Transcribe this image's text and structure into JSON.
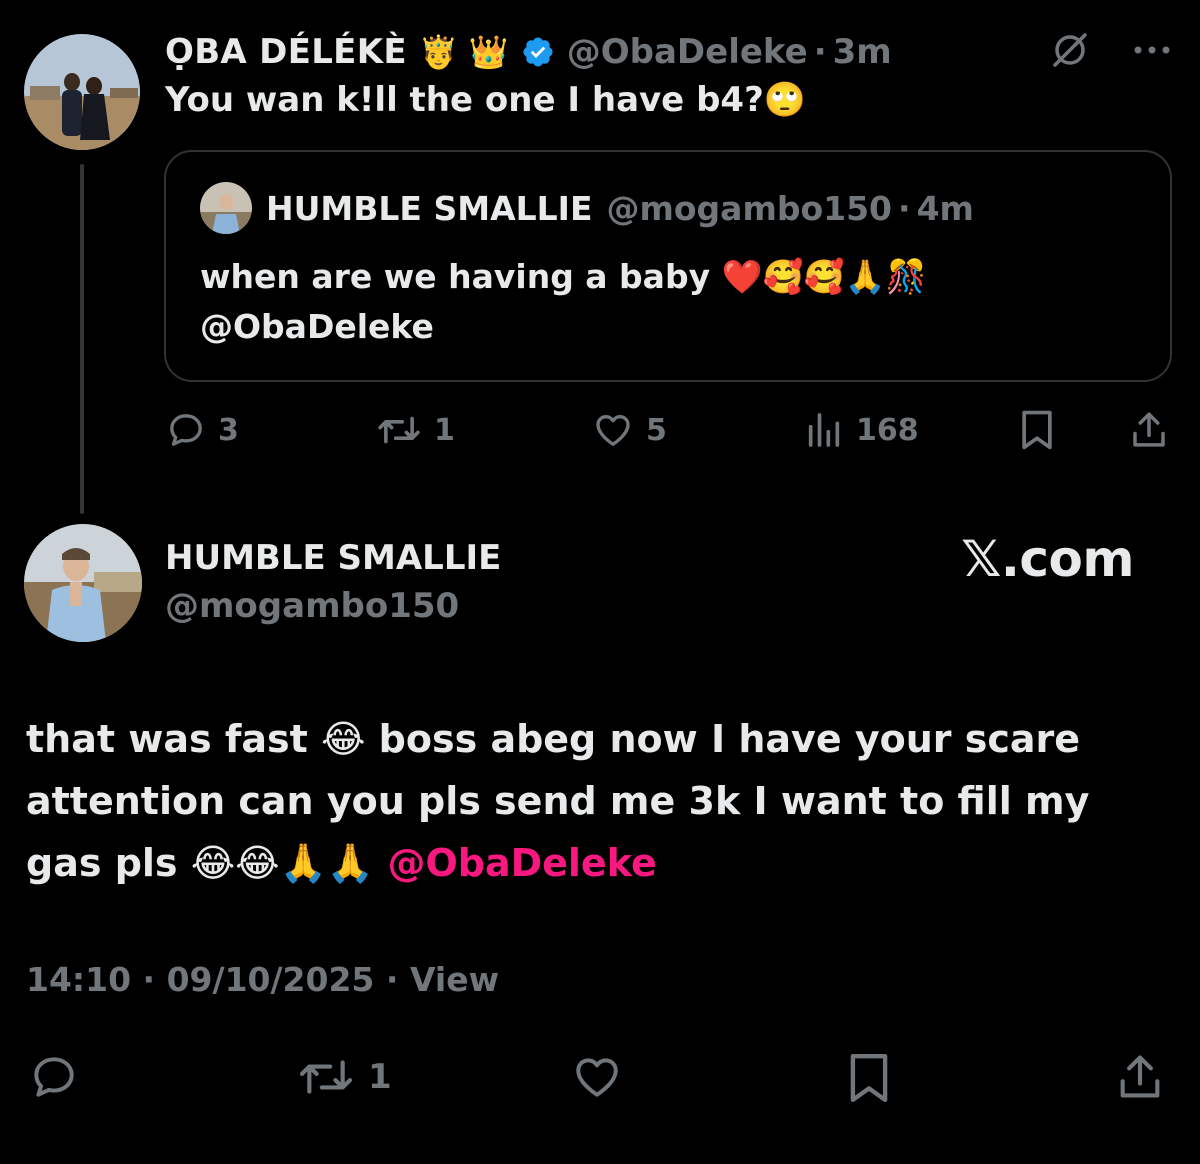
{
  "colors": {
    "background": "#000000",
    "text_primary": "#e7e9ea",
    "text_secondary": "#71767b",
    "mention": "#f91880",
    "verified": "#1d9bf0",
    "border": "#2f3336"
  },
  "main_tweet": {
    "author_name": "ỌBA DÉLÉKÈ",
    "author_emojis": "🤴 👑",
    "handle": "@ObaDeleke",
    "separator": "·",
    "time": "3m",
    "text": "You wan k!ll the one I have b4?🙄",
    "icons": [
      "grok-icon",
      "more-options-icon"
    ]
  },
  "quoted_tweet": {
    "author_name": "HUMBLE SMALLIE",
    "handle": "@mogambo150",
    "separator": "·",
    "time": "4m",
    "text_line1": "when are we having a baby ❤️🥰🥰🙏🎊",
    "text_line2": "@ObaDeleke"
  },
  "main_actions": {
    "replies": "3",
    "reposts": "1",
    "likes": "5",
    "views": "168"
  },
  "reply_tweet": {
    "author_name": "HUMBLE SMALLIE",
    "handle": "@mogambo150",
    "watermark": "𝕏.com",
    "text_part1": "that was fast 😂 boss abeg now I have your scare attention can you pls send me 3k I want to fill my gas pls 😂😂🙏🙏 ",
    "mention": "@ObaDeleke",
    "time": "14:10",
    "separator": "·",
    "date": "09/10/2025",
    "view_link": "View"
  },
  "reply_actions": {
    "reposts": "1"
  }
}
